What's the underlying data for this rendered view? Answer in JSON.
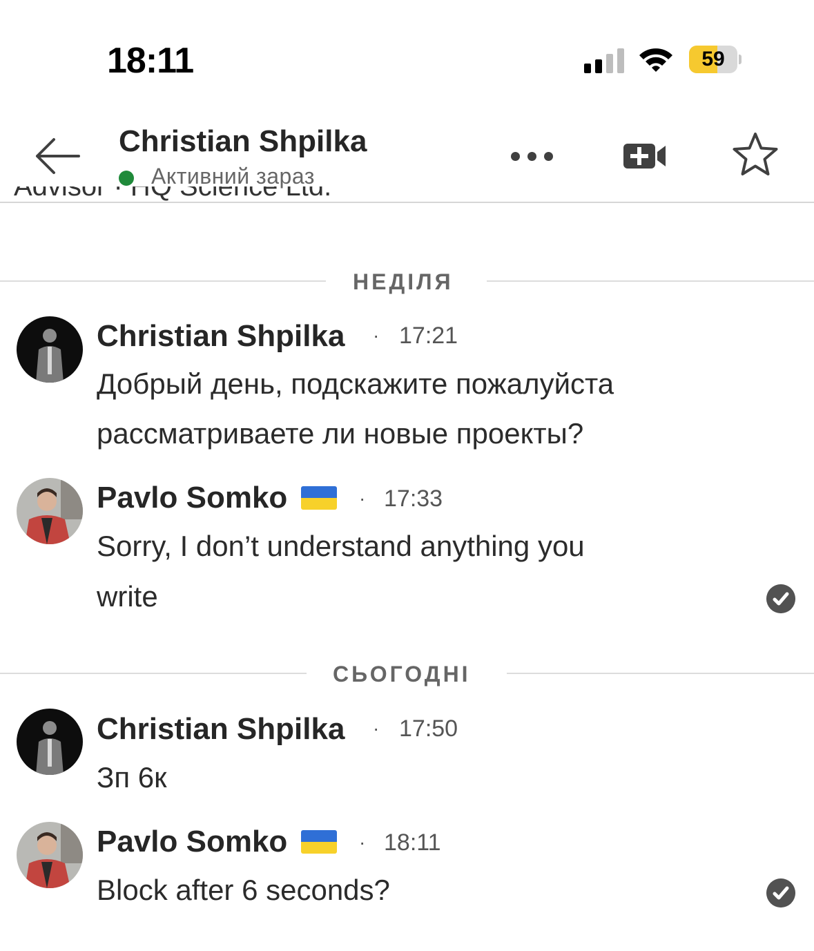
{
  "status_bar": {
    "time": "18:11",
    "battery": "59",
    "battery_level": 0.59
  },
  "header": {
    "contact_name": "Christian Shpilka",
    "status": "Активний зараз",
    "clipped_text": "Advisor · HQ Science Ltd."
  },
  "days": [
    {
      "label": "НЕДІЛЯ"
    },
    {
      "label": "СЬОГОДНІ"
    }
  ],
  "messages": [
    {
      "sender": "Christian Shpilka",
      "sep": "·",
      "time": "17:21",
      "lines": [
        "Добрый день, подскажите пожалуйста",
        "рассматриваете ли новые проекты?"
      ]
    },
    {
      "sender": "Pavlo Somko",
      "sep": "·",
      "time": "17:33",
      "lines": [
        "Sorry, I don’t understand anything you",
        "write"
      ]
    },
    {
      "sender": "Christian Shpilka",
      "sep": "·",
      "time": "17:50",
      "lines": [
        "Зп 6к"
      ]
    },
    {
      "sender": "Pavlo Somko",
      "sep": "·",
      "time": "18:11",
      "lines": [
        "Block after 6 seconds?"
      ]
    }
  ],
  "icons": {
    "back": "arrow-left-icon",
    "more": "more-horizontal-icon",
    "video": "video-call-icon",
    "star": "star-icon",
    "check": "read-check-icon",
    "flag": "ukraine-flag-icon"
  },
  "colors": {
    "online": "#1f8a3a",
    "battery": "#f6c92f",
    "flag_blue": "#2f6fd6",
    "flag_yellow": "#f7d12a"
  }
}
